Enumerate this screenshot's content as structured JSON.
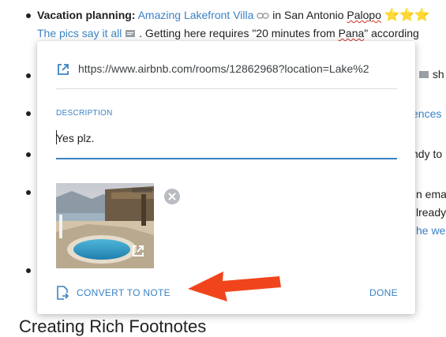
{
  "document": {
    "line1": {
      "prefix": "Vacation planning",
      "colon": ":",
      "link": "Amazing Lakefront Villa",
      "link_icon": "link-icon",
      "middle": "in San Antonio",
      "place": "Palopo",
      "stars": "⭐⭐⭐"
    },
    "line2": {
      "link": "The pics say it all",
      "comment_icon": "comment-icon",
      "text_a": ". Getting here requires \"20 minutes from",
      "place": "Pana",
      "text_b": "\" according"
    },
    "fragments": {
      "r1": "sh",
      "r2": "ences",
      "r3": "ndy to",
      "r4a": "n ema",
      "r4b": "lready",
      "r4c": "he wea"
    },
    "heading": "Creating Rich Footnotes"
  },
  "popup": {
    "url_icon": "open-in-new-icon",
    "url": "https://www.airbnb.com/rooms/12862968?location=Lake%2",
    "description_label": "DESCRIPTION",
    "description_value": "Yes plz.",
    "thumbnail_name": "villa-pool-photo",
    "remove_icon": "remove-circle-icon",
    "thumbnail_open_icon": "open-in-new-icon",
    "convert_icon": "convert-to-note-icon",
    "convert_label": "CONVERT TO NOTE",
    "done_label": "DONE"
  },
  "colors": {
    "accent": "#3b82c4",
    "arrow": "#f0451c",
    "star": "#f5b400"
  }
}
